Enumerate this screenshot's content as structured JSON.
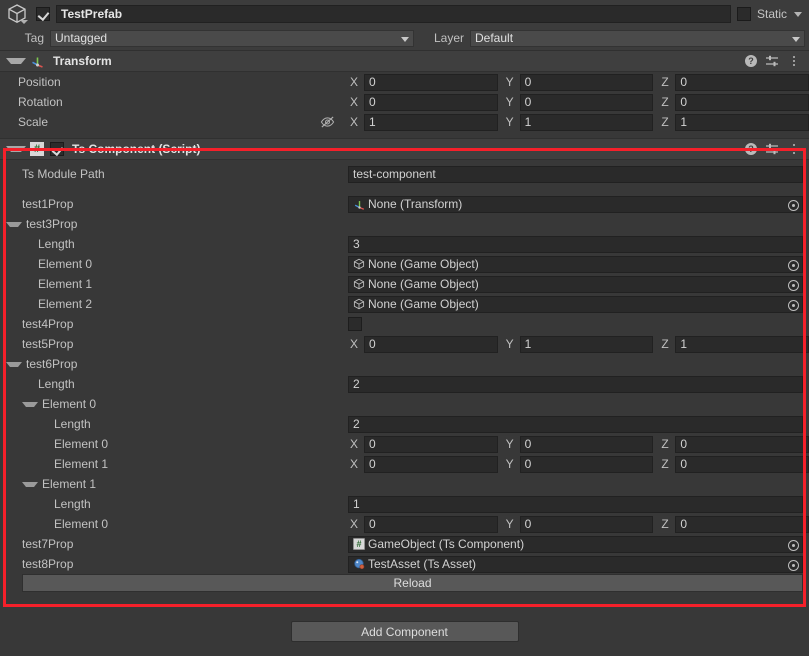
{
  "object_header": {
    "icon": "prefab-cube-icon",
    "enabled": true,
    "name": "TestPrefab",
    "static_label": "Static",
    "static_checked": false,
    "tag_label": "Tag",
    "tag_value": "Untagged",
    "layer_label": "Layer",
    "layer_value": "Default"
  },
  "transform": {
    "title": "Transform",
    "icon": "transform-axis-icon",
    "help_icon": "help-icon",
    "preset_icon": "preset-sliders-icon",
    "menu_icon": "kebab-menu-icon",
    "rows": [
      {
        "label": "Position",
        "x": "0",
        "y": "0",
        "z": "0"
      },
      {
        "label": "Rotation",
        "x": "0",
        "y": "0",
        "z": "0"
      },
      {
        "label": "Scale",
        "x": "1",
        "y": "1",
        "z": "1",
        "eye_icon": "eye-off-icon"
      }
    ],
    "axis_labels": {
      "x": "X",
      "y": "Y",
      "z": "Z"
    }
  },
  "ts_component": {
    "title": "Ts Component (Script)",
    "icon": "csharp-script-icon",
    "icon_glyph": "#",
    "enabled": true,
    "help_icon": "help-icon",
    "preset_icon": "preset-sliders-icon",
    "menu_icon": "kebab-menu-icon",
    "module_path": {
      "label": "Ts Module Path",
      "value": "test-component"
    },
    "properties": [
      {
        "name": "test1Prop-row",
        "label": "test1Prop",
        "indent": 1,
        "kind": "object",
        "value": "None (Transform)",
        "icon": "transform-axis-icon"
      },
      {
        "name": "test3Prop-row",
        "label": "test3Prop",
        "indent": 0,
        "kind": "foldout",
        "expanded": true
      },
      {
        "name": "test3Prop-length",
        "label": "Length",
        "indent": 2,
        "kind": "text",
        "value": "3"
      },
      {
        "name": "test3Prop-element-0",
        "label": "Element 0",
        "indent": 2,
        "kind": "object",
        "value": "None (Game Object)",
        "icon": "gameobject-cube-icon"
      },
      {
        "name": "test3Prop-element-1",
        "label": "Element 1",
        "indent": 2,
        "kind": "object",
        "value": "None (Game Object)",
        "icon": "gameobject-cube-icon"
      },
      {
        "name": "test3Prop-element-2",
        "label": "Element 2",
        "indent": 2,
        "kind": "object",
        "value": "None (Game Object)",
        "icon": "gameobject-cube-icon"
      },
      {
        "name": "test4Prop-row",
        "label": "test4Prop",
        "indent": 1,
        "kind": "bool",
        "checked": false
      },
      {
        "name": "test5Prop-row",
        "label": "test5Prop",
        "indent": 1,
        "kind": "vector3",
        "x": "0",
        "y": "1",
        "z": "1"
      },
      {
        "name": "test6Prop-row",
        "label": "test6Prop",
        "indent": 0,
        "kind": "foldout",
        "expanded": true
      },
      {
        "name": "test6Prop-length",
        "label": "Length",
        "indent": 2,
        "kind": "text",
        "value": "2"
      },
      {
        "name": "test6Prop-element-0",
        "label": "Element 0",
        "indent": 1,
        "kind": "foldout",
        "expanded": true
      },
      {
        "name": "test6Prop-element-0-length",
        "label": "Length",
        "indent": 3,
        "kind": "text",
        "value": "2"
      },
      {
        "name": "test6Prop-element-0-element-0",
        "label": "Element 0",
        "indent": 3,
        "kind": "vector3",
        "x": "0",
        "y": "0",
        "z": "0"
      },
      {
        "name": "test6Prop-element-0-element-1",
        "label": "Element 1",
        "indent": 3,
        "kind": "vector3",
        "x": "0",
        "y": "0",
        "z": "0"
      },
      {
        "name": "test6Prop-element-1",
        "label": "Element 1",
        "indent": 1,
        "kind": "foldout",
        "expanded": true
      },
      {
        "name": "test6Prop-element-1-length",
        "label": "Length",
        "indent": 3,
        "kind": "text",
        "value": "1"
      },
      {
        "name": "test6Prop-element-1-element-0",
        "label": "Element 0",
        "indent": 3,
        "kind": "vector3",
        "x": "0",
        "y": "0",
        "z": "0"
      },
      {
        "name": "test7Prop-row",
        "label": "test7Prop",
        "indent": 1,
        "kind": "object",
        "value": "GameObject (Ts Component)",
        "icon": "csharp-script-icon"
      },
      {
        "name": "test8Prop-row",
        "label": "test8Prop",
        "indent": 1,
        "kind": "object",
        "value": "TestAsset (Ts Asset)",
        "icon": "ts-asset-icon"
      }
    ],
    "reload_button": "Reload"
  },
  "footer": {
    "add_component": "Add Component"
  },
  "colors": {
    "highlight": "#f5202a",
    "panel_bg": "#383838",
    "field_bg": "#2a2a2a",
    "button_bg": "#585858",
    "script_icon_green": "#2d6a33"
  }
}
